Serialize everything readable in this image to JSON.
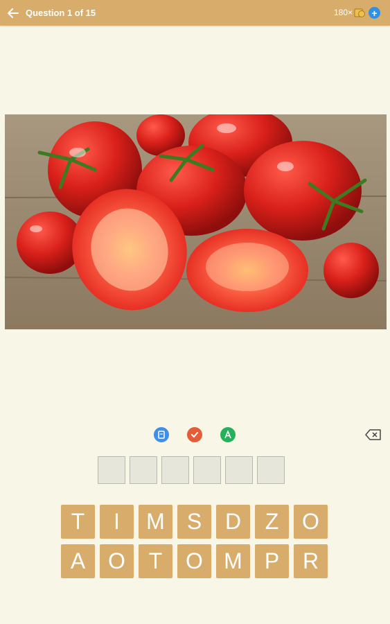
{
  "header": {
    "title": "Question 1 of 15",
    "coins": "180×"
  },
  "hints": [
    {
      "name": "reveal-letter",
      "icon": "book-icon"
    },
    {
      "name": "solve",
      "icon": "check-icon"
    },
    {
      "name": "remove-letter",
      "icon": "letter-a-icon"
    }
  ],
  "answer": {
    "slots": [
      "",
      "",
      "",
      "",
      "",
      ""
    ]
  },
  "letters": {
    "row1": [
      "T",
      "I",
      "M",
      "S",
      "D",
      "Z",
      "O"
    ],
    "row2": [
      "A",
      "O",
      "T",
      "O",
      "M",
      "P",
      "R"
    ]
  },
  "colors": {
    "accent": "#d8ac6a",
    "background": "#f8f6e6",
    "blue": "#3f8ee9",
    "orange": "#e35d39",
    "green": "#25b15a"
  }
}
